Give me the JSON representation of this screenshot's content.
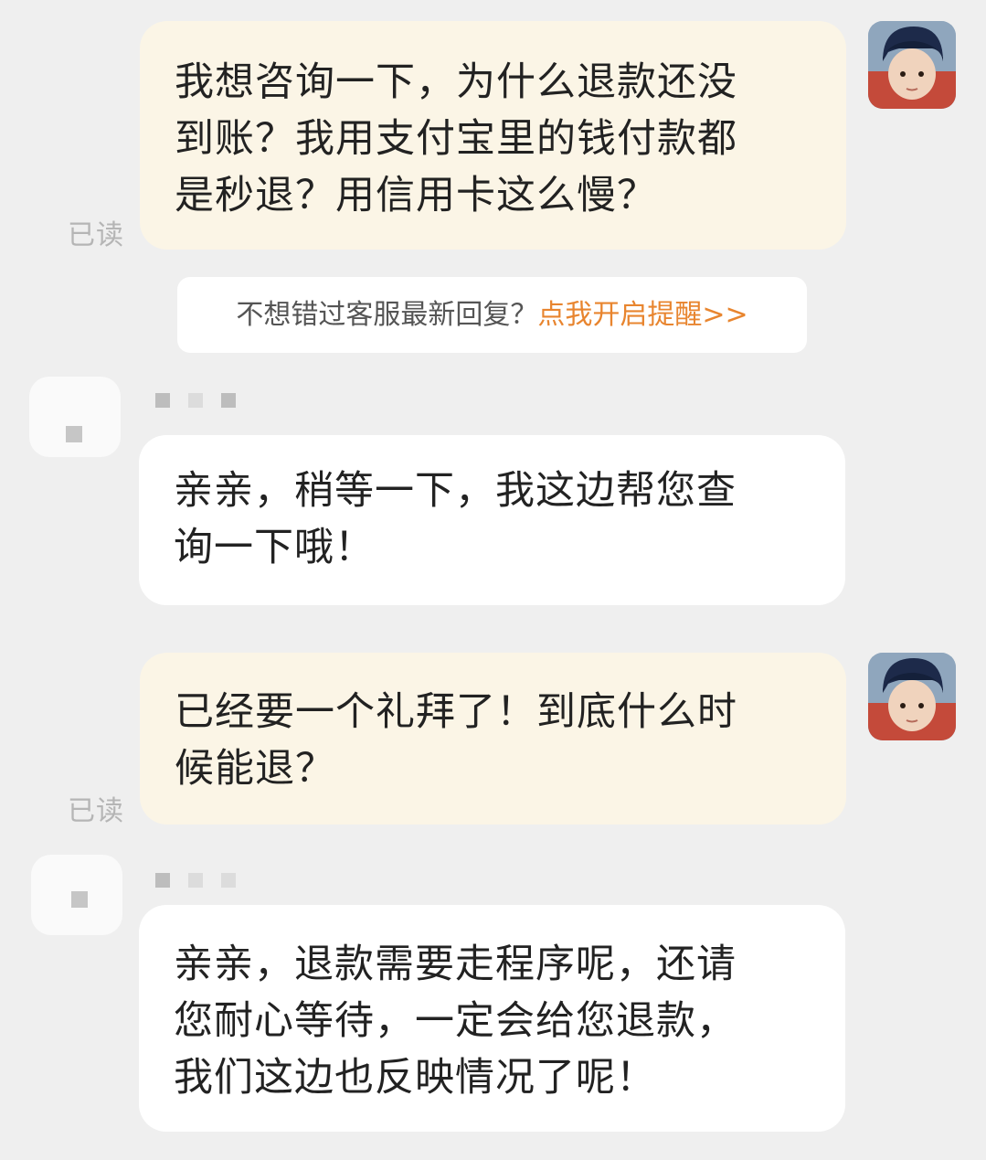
{
  "chat": {
    "messages": [
      {
        "sender": "user",
        "text": "我想咨询一下，为什么退款还没\n到账？我用支付宝里的钱付款都\n是秒退？用信用卡这么慢？",
        "status": "已读"
      },
      {
        "sender": "agent",
        "text": "亲亲，稍等一下，我这边帮您查\n询一下哦！"
      },
      {
        "sender": "user",
        "text": "已经要一个礼拜了！到底什么时\n候能退？",
        "status": "已读"
      },
      {
        "sender": "agent",
        "text": "亲亲，退款需要走程序呢，还请\n您耐心等待，一定会给您退款，\n我们这边也反映情况了呢！"
      }
    ],
    "notice": {
      "text": "不想错过客服最新回复？",
      "link": "点我开启提醒>>"
    }
  },
  "colors": {
    "background": "#efefef",
    "outgoing_bubble": "#fbf5e6",
    "incoming_bubble": "#ffffff",
    "notice_link": "#e8852f",
    "read_status": "#b5b5b5"
  },
  "icons": {
    "user_avatar": "user-avatar-photo",
    "agent_avatar": "agent-avatar-blurred"
  }
}
